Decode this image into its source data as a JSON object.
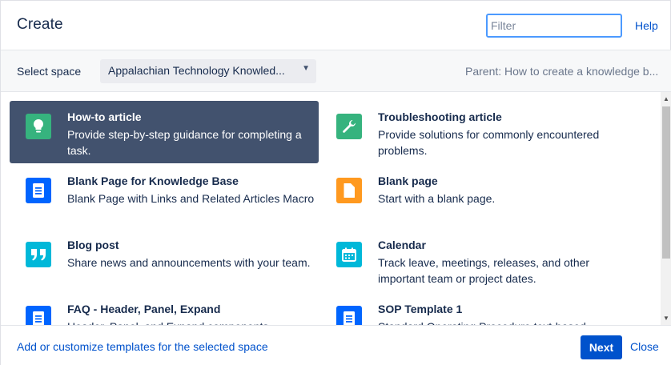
{
  "header": {
    "title": "Create",
    "filter_placeholder": "Filter",
    "help_label": "Help"
  },
  "space": {
    "label": "Select space",
    "selected": "Appalachian Technology Knowled...",
    "parent": "Parent: How to create a knowledge b..."
  },
  "templates": [
    {
      "name": "How-to article",
      "description": "Provide step-by-step guidance for completing a task.",
      "icon": "lightbulb-icon",
      "color": "#36b37e",
      "selected": true
    },
    {
      "name": "Troubleshooting article",
      "description": "Provide solutions for commonly encountered problems.",
      "icon": "wrench-icon",
      "color": "#36b37e",
      "selected": false
    },
    {
      "name": "Blank Page for Knowledge Base",
      "description": "Blank Page with Links and Related Articles Macro",
      "icon": "document-icon",
      "color": "#0065ff",
      "selected": false
    },
    {
      "name": "Blank page",
      "description": "Start with a blank page.",
      "icon": "blank-page-icon",
      "color": "#ff991f",
      "selected": false
    },
    {
      "name": "Blog post",
      "description": "Share news and announcements with your team.",
      "icon": "quote-icon",
      "color": "#00b8d9",
      "selected": false
    },
    {
      "name": "Calendar",
      "description": "Track leave, meetings, releases, and other important team or project dates.",
      "icon": "calendar-icon",
      "color": "#00b8d9",
      "selected": false
    },
    {
      "name": "FAQ - Header, Panel, Expand",
      "description": "Header, Panel, and Expand components",
      "icon": "document-icon",
      "color": "#0065ff",
      "selected": false
    },
    {
      "name": "SOP Template 1",
      "description": "Standard Operating Procedure text-based",
      "icon": "document-icon",
      "color": "#0065ff",
      "selected": false
    }
  ],
  "footer": {
    "add_link": "Add or customize templates for the selected space",
    "next_label": "Next",
    "close_label": "Close"
  },
  "colors": {
    "accent": "#0052cc",
    "selected_bg": "#42526e",
    "focus_border": "#4c9aff"
  }
}
